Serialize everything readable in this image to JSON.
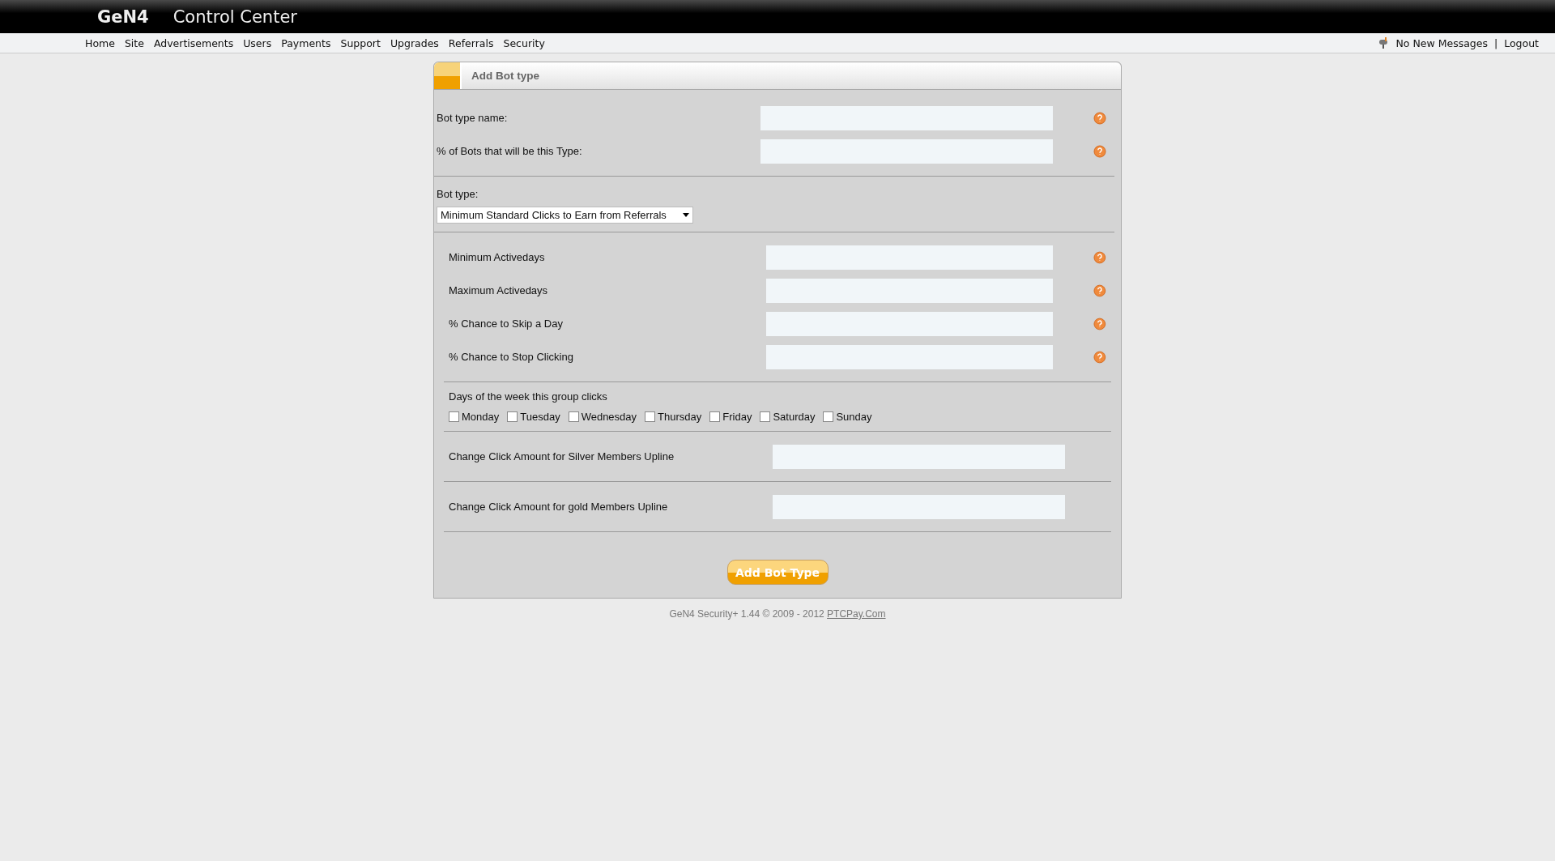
{
  "header": {
    "logo": "GeN4",
    "title": "Control Center"
  },
  "nav": [
    "Home",
    "Site",
    "Advertisements",
    "Users",
    "Payments",
    "Support",
    "Upgrades",
    "Referrals",
    "Security"
  ],
  "user_links": {
    "messages": "No New Messages",
    "separator": "|",
    "logout": "Logout"
  },
  "panel": {
    "title": "Add Bot type",
    "sections": [
      {
        "kind": "fields",
        "fields": [
          {
            "label": "Bot type name:",
            "help": true
          },
          {
            "label": "% of Bots that will be this Type:",
            "help": true
          }
        ]
      },
      {
        "kind": "select",
        "label": "Bot type:",
        "value": "Minimum Standard Clicks to Earn from Referrals"
      },
      {
        "kind": "fields",
        "fields": [
          {
            "label": "Minimum Activedays",
            "help": true
          },
          {
            "label": "Maximum Activedays",
            "help": true
          },
          {
            "label": "% Chance to Skip a Day",
            "help": true
          },
          {
            "label": "% Chance to Stop Clicking",
            "help": true
          }
        ]
      },
      {
        "kind": "days",
        "label": "Days of the week this group clicks",
        "days": [
          {
            "label": "Monday",
            "checked": false
          },
          {
            "label": "Tuesday",
            "checked": false
          },
          {
            "label": "Wednesday",
            "checked": false
          },
          {
            "label": "Thursday",
            "checked": false
          },
          {
            "label": "Friday",
            "checked": false
          },
          {
            "label": "Saturday",
            "checked": false
          },
          {
            "label": "Sunday",
            "checked": false
          }
        ]
      },
      {
        "kind": "fields",
        "fields": [
          {
            "label": "Change Click Amount for Silver Members Upline",
            "help": false
          }
        ]
      },
      {
        "kind": "fields",
        "fields": [
          {
            "label": "Change Click Amount for gold Members Upline",
            "help": false
          }
        ]
      }
    ],
    "submit": "Add Bot Type"
  },
  "footer": {
    "text": "GeN4 Security+ 1.44 © 2009 - 2012",
    "link": "PTCPay.Com"
  }
}
